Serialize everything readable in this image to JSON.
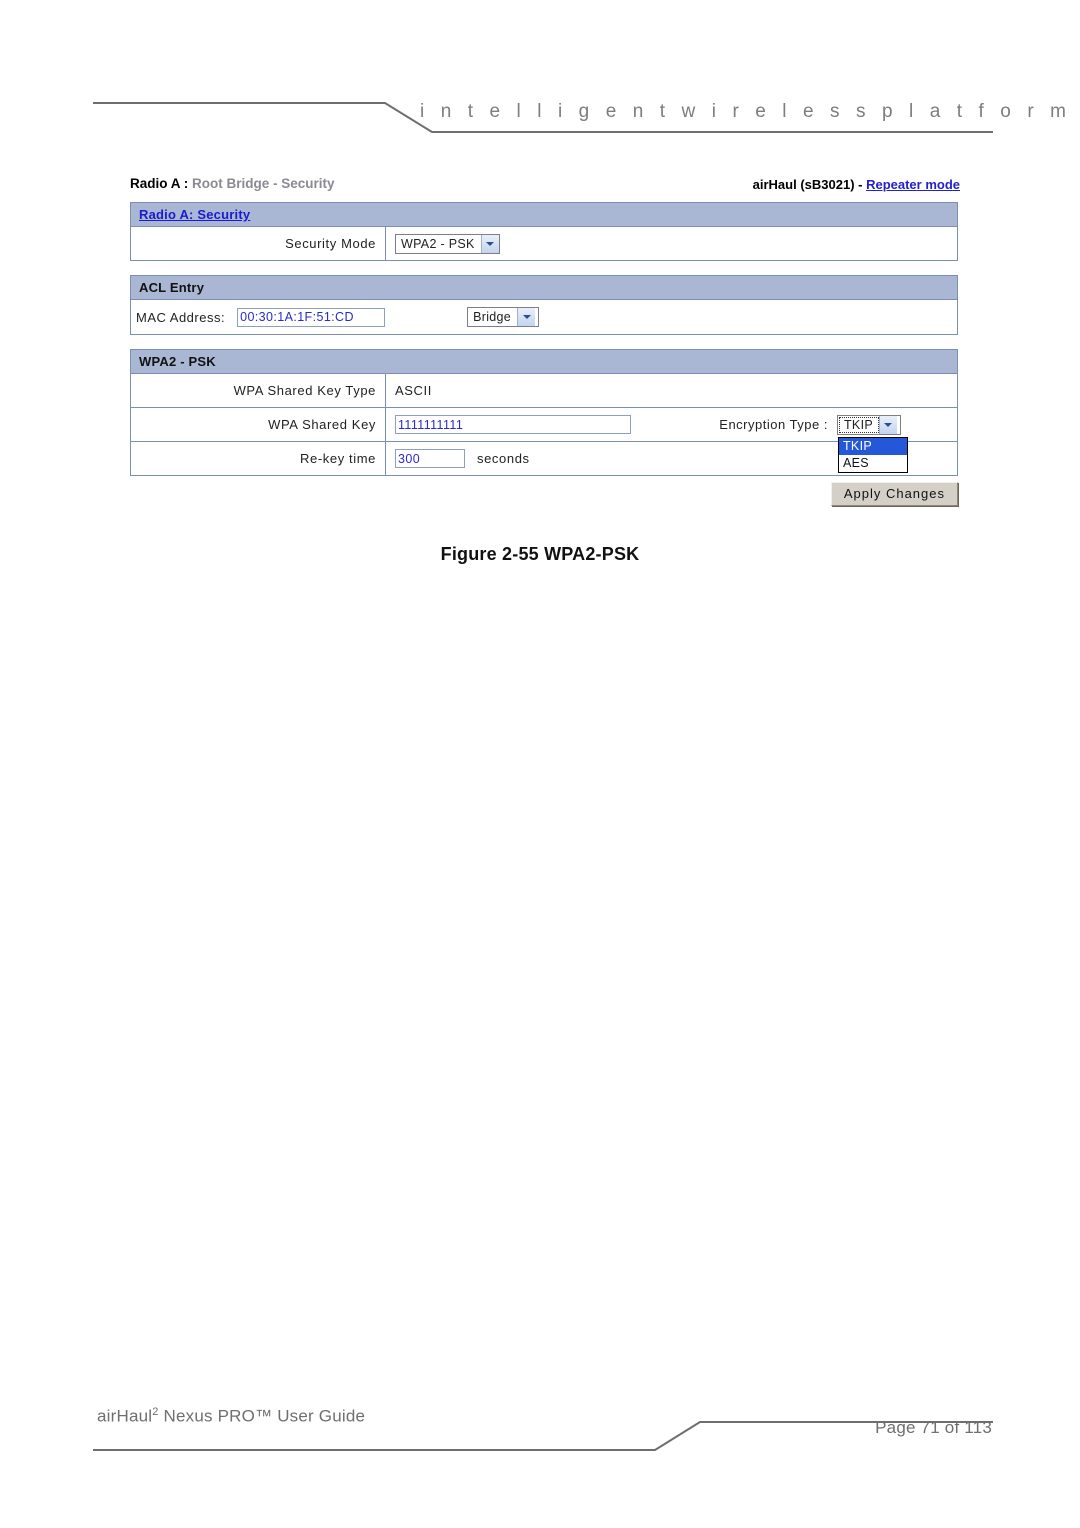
{
  "header": {
    "tagline": "i n t e l l i g e n t     w i r e l e s s     p l a t f o r m"
  },
  "breadcrumb": {
    "primary": "Radio A :",
    "secondary": "Root Bridge -  Security"
  },
  "device_info": {
    "prefix": "airHaul (sB3021) - ",
    "mode_link": "Repeater mode"
  },
  "security_panel": {
    "title": "Radio A: Security",
    "security_mode_label": "Security Mode",
    "security_mode_value": "WPA2 - PSK"
  },
  "acl_panel": {
    "title": "ACL Entry",
    "mac_label": "MAC Address:",
    "mac_value": "00:30:1A:1F:51:CD",
    "acl_action_value": "Bridge"
  },
  "wpa_panel": {
    "title": "WPA2 - PSK",
    "key_type_label": "WPA Shared Key Type",
    "key_type_value": "ASCII",
    "shared_key_label": "WPA Shared Key",
    "shared_key_value": "1111111111",
    "encryption_label": "Encryption Type :",
    "encryption_value": "TKIP",
    "encryption_options": [
      "TKIP",
      "AES"
    ],
    "encryption_selected_index": 0,
    "rekey_label": "Re-key time",
    "rekey_value": "300",
    "rekey_units": "seconds"
  },
  "actions": {
    "apply_label": "Apply Changes"
  },
  "figure": {
    "caption": "Figure 2-55 WPA2-PSK"
  },
  "footer": {
    "guide_pre": "airHaul",
    "guide_sup": "2",
    "guide_post": " Nexus PRO™ User Guide",
    "page_text": "Page 71 of 113"
  },
  "colors": {
    "panel_header_bg": "#aab7d4",
    "panel_border": "#7b8fb5",
    "link_blue": "#1a1ad0",
    "input_text_blue": "#2a2ad0",
    "dropdown_highlight": "#2458d8",
    "tagline_gray": "#7d7d7d",
    "footer_gray": "#6f6f6f"
  }
}
